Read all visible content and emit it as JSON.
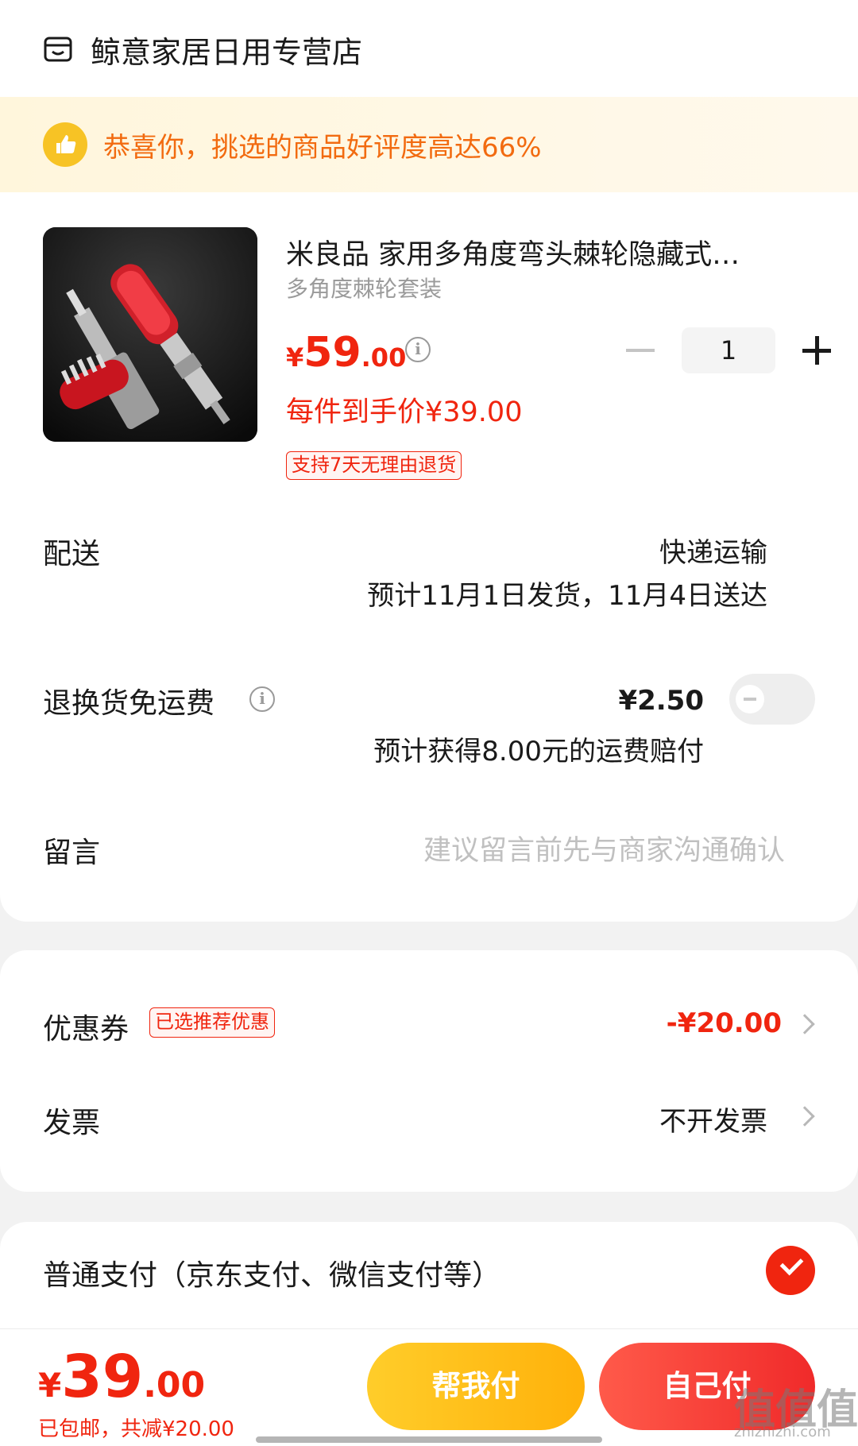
{
  "store": {
    "name": "鲸意家居日用专营店",
    "icon": "store-icon"
  },
  "banner": {
    "text": "恭喜你，挑选的商品好评度高达66%",
    "icon": "thumbs-up-icon",
    "color": "#f26b10"
  },
  "product": {
    "title": "米良品 家用多角度弯头棘轮隐藏式…",
    "spec": "多角度棘轮套装",
    "price_yen": "¥",
    "price_int": "59",
    "price_dec": ".00",
    "hand_price": "每件到手价¥39.00",
    "return_tag": "支持7天无理由退货",
    "quantity": "1"
  },
  "delivery": {
    "label": "配送",
    "method": "快递运输",
    "estimate": "预计11月1日发货，11月4日送达"
  },
  "return_shipping": {
    "label": "退换货免运费",
    "price": "¥2.50",
    "note": "预计获得8.00元的运费赔付",
    "toggle_on": false
  },
  "message": {
    "label": "留言",
    "placeholder": "建议留言前先与商家沟通确认"
  },
  "coupon": {
    "label": "优惠券",
    "tag": "已选推荐优惠",
    "value": "-¥20.00"
  },
  "invoice": {
    "label": "发票",
    "value": "不开发票"
  },
  "payment": {
    "label": "普通支付（京东支付、微信支付等）",
    "selected": true
  },
  "footer": {
    "total_yen": "¥",
    "total_int": "39",
    "total_dec": ".00",
    "sub": "已包邮，共减¥20.00",
    "help_pay": "帮我付",
    "self_pay": "自己付"
  },
  "watermark": {
    "main": "值值值",
    "sub": "zhizhizhi.com"
  },
  "colors": {
    "accent_red": "#f0250f",
    "accent_yellow": "#ffc21a",
    "banner_bg": "#fff6dc"
  }
}
